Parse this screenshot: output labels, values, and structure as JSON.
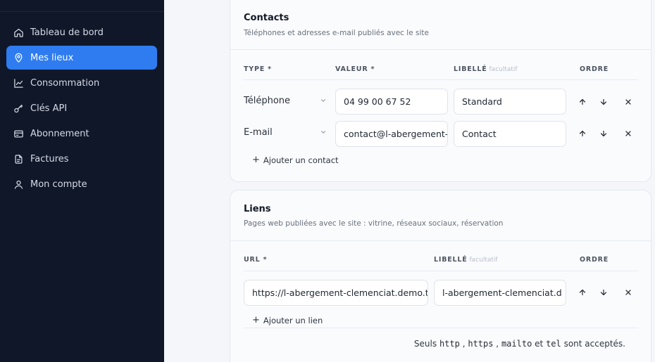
{
  "sidebar": {
    "items": [
      {
        "label": "Tableau de bord",
        "icon": "home-icon"
      },
      {
        "label": "Mes lieux",
        "icon": "map-pin-icon"
      },
      {
        "label": "Consommation",
        "icon": "line-chart-icon"
      },
      {
        "label": "Clés API",
        "icon": "key-icon"
      },
      {
        "label": "Abonnement",
        "icon": "credit-card-icon"
      },
      {
        "label": "Factures",
        "icon": "file-text-icon"
      },
      {
        "label": "Mon compte",
        "icon": "user-icon"
      }
    ],
    "active_index": 1
  },
  "contacts": {
    "title": "Contacts",
    "subtitle": "Téléphones et adresses e-mail publiés avec le site",
    "headers": {
      "type": "TYPE *",
      "value": "VALEUR *",
      "label": "LIBELLÉ",
      "label_opt": "facultatif",
      "order": "ORDRE"
    },
    "rows": [
      {
        "type": "Téléphone",
        "value": "04 99 00 67 52",
        "label": "Standard"
      },
      {
        "type": "E-mail",
        "value": "contact@l-abergement-clemenciat.fr",
        "label": "Contact"
      }
    ],
    "add_label": "Ajouter un contact"
  },
  "links": {
    "title": "Liens",
    "subtitle": "Pages web publiées avec le site : vitrine, réseaux sociaux, réservation",
    "headers": {
      "url": "URL *",
      "label": "LIBELLÉ",
      "label_opt": "facultatif",
      "order": "ORDRE"
    },
    "rows": [
      {
        "url": "https://l-abergement-clemenciat.demo.t",
        "label": "l-abergement-clemenciat.d"
      }
    ],
    "add_label": "Ajouter un lien",
    "hint": {
      "prefix": "Seuls",
      "schemes": [
        "http",
        "https",
        "mailto",
        "tel"
      ],
      "sep": ",",
      "and": "et",
      "suffix": "sont acceptés."
    }
  },
  "colors": {
    "sidebar_bg": "#0f1729",
    "accent": "#2e7cf0",
    "main_bg": "#f4f6f9"
  }
}
